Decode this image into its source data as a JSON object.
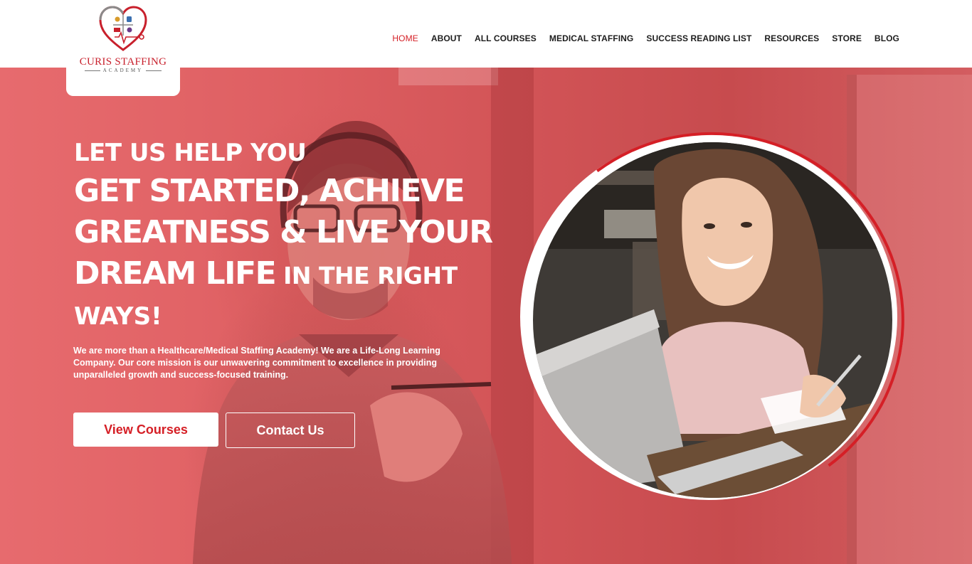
{
  "logo": {
    "title": "CURIS STAFFING",
    "subtitle": "ACADEMY"
  },
  "nav": {
    "items": [
      {
        "label": "HOME",
        "active": true
      },
      {
        "label": "ABOUT"
      },
      {
        "label": "ALL COURSES"
      },
      {
        "label": "MEDICAL STAFFING"
      },
      {
        "label": "SUCCESS READING LIST"
      },
      {
        "label": "RESOURCES"
      },
      {
        "label": "STORE"
      },
      {
        "label": "BLOG"
      }
    ]
  },
  "hero": {
    "line1": "LET US HELP YOU",
    "line2": "GET STARTED, ACHIEVE",
    "line3": "GREATNESS & LIVE YOUR",
    "line4_big": "DREAM LIFE",
    "line4_small": " IN THE RIGHT",
    "line5": "WAYS!",
    "description": "We are more than a Healthcare/Medical Staffing Academy! We are a Life-Long Learning Company.  Our core mission is our unwavering commitment to excellence in providing unparalleled growth and success-focused training.",
    "primary_button": "View Courses",
    "secondary_button": "Contact Us"
  },
  "colors": {
    "brand_red": "#d51f26",
    "hero_overlay": "#de5f62",
    "text_dark": "#1d1d1d"
  }
}
